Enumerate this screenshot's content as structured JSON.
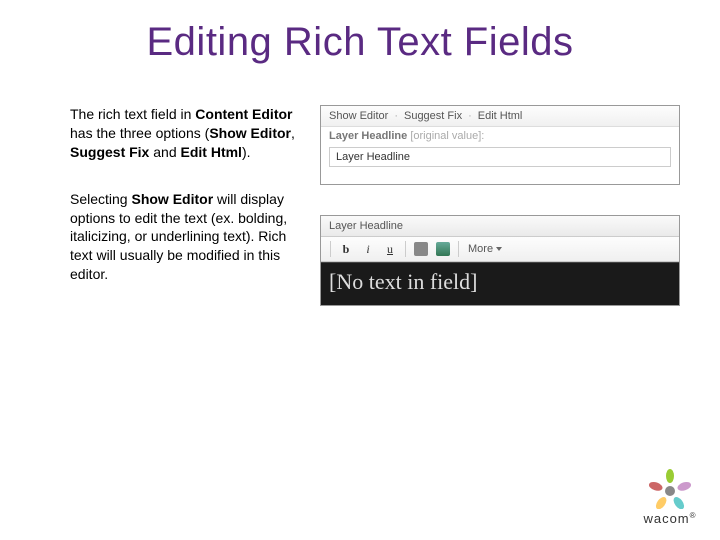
{
  "title": "Editing Rich Text Fields",
  "para1": {
    "t1": "The rich text field in ",
    "b1": "Content Editor",
    "t2": " has the three options (",
    "b2": "Show Editor",
    "t3": ", ",
    "b3": "Suggest Fix",
    "t4": " and ",
    "b4": "Edit Html",
    "t5": ")."
  },
  "para2": {
    "t1": "Selecting ",
    "b1": "Show Editor",
    "t2": " will display options to edit the text (ex. bolding, italicizing, or underlining text). Rich text will usually be modified in this editor."
  },
  "panel1": {
    "link1": "Show Editor",
    "link2": "Suggest Fix",
    "link3": "Edit Html",
    "label": "Layer Headline",
    "labelSuffix": " [original value]:",
    "value": "Layer Headline"
  },
  "panel2": {
    "tab": "Layer Headline",
    "bold": "b",
    "italic": "i",
    "underline": "u",
    "more": "More",
    "body": "[No text in field]"
  },
  "logo": {
    "text": "wacom",
    "reg": "®"
  }
}
